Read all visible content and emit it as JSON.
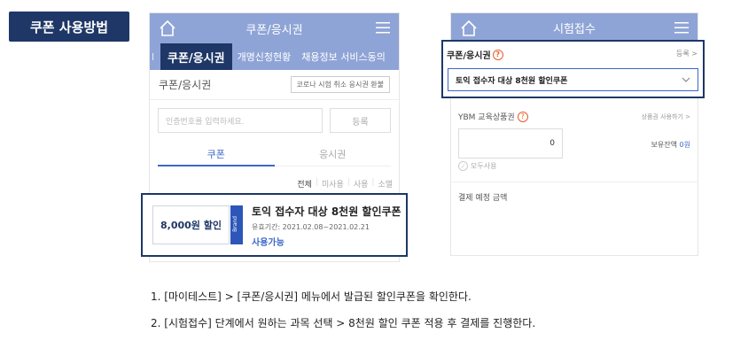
{
  "badge": "쿠폰 사용방법",
  "left_phone": {
    "appbar_title": "쿠폰/응시권",
    "tab_edge": "l",
    "tabs": [
      "쿠폰/응시권",
      "개명신청현황",
      "채용정보 서비스동의"
    ],
    "coupon_label": "쿠폰/응시권",
    "refund_button": "코로나 시험 취소 응시권 환불",
    "code_placeholder": "인증번호를 입력하세요.",
    "register_button": "등록",
    "subtabs": [
      "쿠폰",
      "응시권"
    ],
    "filters": [
      "전체",
      "미사용",
      "사용",
      "소멸"
    ],
    "coupon": {
      "amount": "8,000원 할인",
      "strip": "Brand",
      "title": "토익 접수자 대상 8천원 할인쿠폰",
      "period": "유효기간: 2021.02.08~2021.02.21",
      "status": "사용가능"
    }
  },
  "right_phone": {
    "appbar_title": "시험접수",
    "coupon_label": "쿠폰/응시권",
    "register_link": "등록 >",
    "selected_coupon": "토익 접수자 대상 8천원 할인쿠폰",
    "ybm_label": "YBM 교육상품권",
    "ybm_link": "상품권 사용하기 >",
    "ybm_value": "0",
    "balance_label": "보유잔액",
    "balance_value": "0원",
    "use_all": "모두사용",
    "payment_label": "결제 예정 금액"
  },
  "steps": [
    "1. [마이테스트] > [쿠폰/응시권] 메뉴에서 발급된 할인쿠폰을 확인한다.",
    "2. [시험접수] 단계에서 원하는 과목 선택 > 8천원 할인 쿠폰 적용 후 결제를 진행한다."
  ],
  "colors": {
    "navy": "#1e3766",
    "appbar": "#8fa4d6",
    "accent": "#3c68c8",
    "help": "#e85c2a"
  },
  "icons": [
    "home-icon",
    "menu-icon",
    "help-icon",
    "chevron-down-icon",
    "check-icon"
  ]
}
